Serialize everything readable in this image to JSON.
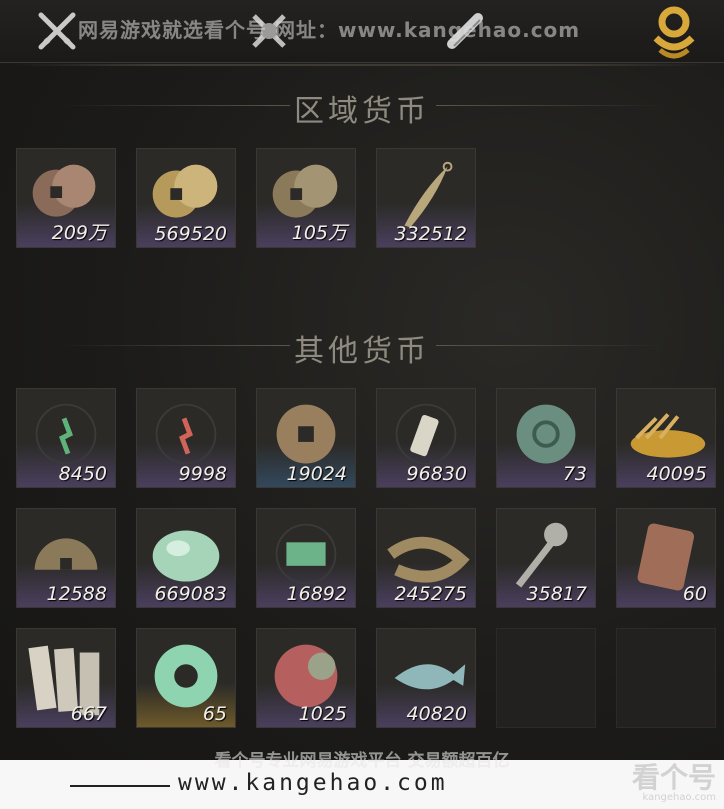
{
  "top_bar": {
    "watermark_text": "网易游戏就选看个号  网址：www.kangehao.com",
    "tabs": [
      "crossed-swords-icon",
      "x-shield-icon",
      "scroll-icon"
    ],
    "accent_icon": "gold-coin-tab-icon"
  },
  "regional_currency": {
    "title": "区域货币",
    "items": [
      {
        "icon": "copper-coins-icon",
        "count": "209万"
      },
      {
        "icon": "gold-coins-icon",
        "count": "569520"
      },
      {
        "icon": "bronze-coins-icon",
        "count": "105万"
      },
      {
        "icon": "feather-blade-icon",
        "count": "332512"
      }
    ]
  },
  "other_currency": {
    "title": "其他货币",
    "items": [
      {
        "icon": "green-sigil-icon",
        "count": "8450"
      },
      {
        "icon": "red-sigil-icon",
        "count": "9998"
      },
      {
        "icon": "ancient-coin-icon",
        "count": "19024"
      },
      {
        "icon": "jade-token-icon",
        "count": "96830"
      },
      {
        "icon": "jade-disc-icon",
        "count": "73"
      },
      {
        "icon": "grain-pile-icon",
        "count": "40095"
      },
      {
        "icon": "half-coin-icon",
        "count": "12588"
      },
      {
        "icon": "jade-stone-icon",
        "count": "669083"
      },
      {
        "icon": "green-tablet-icon",
        "count": "16892"
      },
      {
        "icon": "coin-string-icon",
        "count": "245275"
      },
      {
        "icon": "key-coin-icon",
        "count": "35817"
      },
      {
        "icon": "bronze-tablet-icon",
        "count": "60"
      },
      {
        "icon": "paper-notes-icon",
        "count": "667"
      },
      {
        "icon": "jade-ring-icon",
        "count": "65"
      },
      {
        "icon": "red-jade-disc-icon",
        "count": "1025"
      },
      {
        "icon": "jade-fish-icon",
        "count": "40820"
      }
    ]
  },
  "bottom_banner": {
    "slogan": "看个号专业网易游戏平台  交易额超百亿",
    "url": "www.kangehao.com",
    "brand": "看个号",
    "brand_sub": "kangehao.com"
  },
  "colors": {
    "background": "#1c1b19",
    "cell_purple": "#4a3f5e",
    "cell_blue": "#33485c",
    "cell_gold": "#6e5a2a",
    "count_text": "#f2efe8"
  }
}
